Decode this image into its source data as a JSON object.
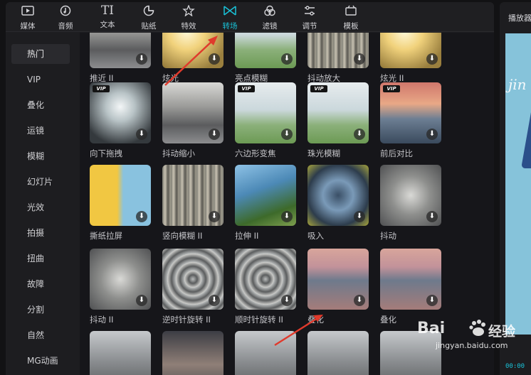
{
  "toolbar": {
    "tools": [
      {
        "label": "媒体",
        "icon": "media-icon",
        "active": false
      },
      {
        "label": "音频",
        "icon": "audio-icon",
        "active": false
      },
      {
        "label": "文本",
        "icon": "text-icon",
        "active": false
      },
      {
        "label": "贴纸",
        "icon": "sticker-icon",
        "active": false
      },
      {
        "label": "特效",
        "icon": "effects-icon",
        "active": false
      },
      {
        "label": "转场",
        "icon": "transition-icon",
        "active": true
      },
      {
        "label": "滤镜",
        "icon": "filter-icon",
        "active": false
      },
      {
        "label": "调节",
        "icon": "adjust-icon",
        "active": false
      },
      {
        "label": "模板",
        "icon": "template-icon",
        "active": false
      }
    ],
    "text_glyph": "TI"
  },
  "sidebar": {
    "items": [
      {
        "label": "热门",
        "active": true
      },
      {
        "label": "VIP"
      },
      {
        "label": "叠化"
      },
      {
        "label": "运镜"
      },
      {
        "label": "模糊"
      },
      {
        "label": "幻灯片"
      },
      {
        "label": "光效"
      },
      {
        "label": "拍摄"
      },
      {
        "label": "扭曲"
      },
      {
        "label": "故障"
      },
      {
        "label": "分割"
      },
      {
        "label": "自然"
      },
      {
        "label": "MG动画"
      }
    ]
  },
  "grid": {
    "vip_badge": "VIP",
    "rows": [
      [
        {
          "name": "推近 II",
          "vip": false,
          "theme": "city"
        },
        {
          "name": "炫光",
          "vip": false,
          "theme": "glare"
        },
        {
          "name": "亮点模糊",
          "vip": false,
          "theme": "girl"
        },
        {
          "name": "抖动放大",
          "vip": false,
          "theme": "blurstreak"
        },
        {
          "name": "炫光 II",
          "vip": false,
          "theme": "glare"
        }
      ],
      [
        {
          "name": "向下拖拽",
          "vip": true,
          "theme": "light"
        },
        {
          "name": "抖动缩小",
          "vip": false,
          "theme": "city"
        },
        {
          "name": "六边形变焦",
          "vip": true,
          "theme": "girl"
        },
        {
          "name": "珠光模糊",
          "vip": true,
          "theme": "girl"
        },
        {
          "name": "前后对比",
          "vip": true,
          "theme": "sunset"
        }
      ],
      [
        {
          "name": "撕纸拉屏",
          "vip": false,
          "theme": "girls"
        },
        {
          "name": "竖向模糊 II",
          "vip": false,
          "theme": "blurstreak"
        },
        {
          "name": "拉伸 II",
          "vip": false,
          "theme": "wheel"
        },
        {
          "name": "吸入",
          "vip": false,
          "theme": "zoom"
        },
        {
          "name": "抖动",
          "vip": false,
          "theme": "swirl"
        }
      ],
      [
        {
          "name": "抖动 II",
          "vip": false,
          "theme": "swirl"
        },
        {
          "name": "逆时针旋转 II",
          "vip": false,
          "theme": "ring"
        },
        {
          "name": "顺时针旋转 II",
          "vip": false,
          "theme": "ring"
        },
        {
          "name": "叠化",
          "vip": false,
          "theme": "lake"
        },
        {
          "name": "叠化",
          "vip": false,
          "theme": "lake"
        }
      ],
      [
        {
          "name": "",
          "vip": false,
          "theme": "street"
        },
        {
          "name": "",
          "vip": false,
          "theme": "dusk"
        },
        {
          "name": "",
          "vip": false,
          "theme": "street"
        },
        {
          "name": "",
          "vip": false,
          "theme": "street"
        },
        {
          "name": "",
          "vip": false,
          "theme": "street"
        }
      ]
    ]
  },
  "player": {
    "title": "播放器",
    "preview_text": "jin",
    "time": "00:00"
  },
  "watermark": {
    "logo": "Bai",
    "cn": "经验",
    "url": "jingyan.baidu.com"
  },
  "colors": {
    "accent": "#19c2d8",
    "arrow": "#e03a2c"
  }
}
